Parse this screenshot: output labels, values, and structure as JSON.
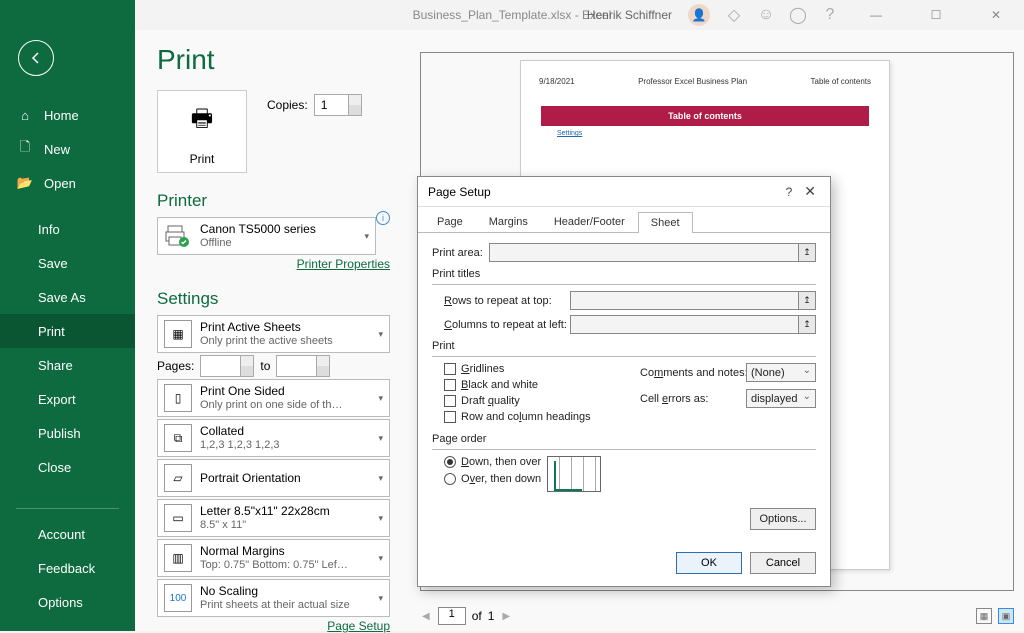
{
  "titlebar": {
    "filename": "Business_Plan_Template.xlsx  -  Excel",
    "user": "Henrik Schiffner"
  },
  "sidebar": {
    "home": "Home",
    "new": "New",
    "open": "Open",
    "info": "Info",
    "save": "Save",
    "save_as": "Save As",
    "print": "Print",
    "share": "Share",
    "export": "Export",
    "publish": "Publish",
    "close": "Close",
    "account": "Account",
    "feedback": "Feedback",
    "options": "Options"
  },
  "print": {
    "title": "Print",
    "print_btn": "Print",
    "copies_label": "Copies:",
    "copies_value": "1",
    "printer_section": "Printer",
    "printer_name": "Canon TS5000 series",
    "printer_status": "Offline",
    "printer_props": "Printer Properties",
    "settings_section": "Settings",
    "active_sheets_t": "Print Active Sheets",
    "active_sheets_s": "Only print the active sheets",
    "pages_label": "Pages:",
    "pages_to": "to",
    "one_sided_t": "Print One Sided",
    "one_sided_s": "Only print on one side of th…",
    "collated_t": "Collated",
    "collated_s": "1,2,3    1,2,3    1,2,3",
    "orientation": "Portrait Orientation",
    "paper_t": "Letter 8.5\"x11\" 22x28cm",
    "paper_s": "8.5\" x 11\"",
    "margins_t": "Normal Margins",
    "margins_s": "Top: 0.75\" Bottom: 0.75\" Lef…",
    "scaling_t": "No Scaling",
    "scaling_s": "Print sheets at their actual size",
    "page_setup_link": "Page Setup"
  },
  "preview": {
    "date": "9/18/2021",
    "center": "Professor Excel Business Plan",
    "right": "Table of contents",
    "toc_bar": "Table of contents",
    "link": "Settings",
    "page_current": "1",
    "page_of": "of",
    "page_total": "1"
  },
  "dialog": {
    "title": "Page Setup",
    "tab_page": "Page",
    "tab_margins": "Margins",
    "tab_hf": "Header/Footer",
    "tab_sheet": "Sheet",
    "print_area": "Print area:",
    "print_titles": "Print titles",
    "rows_repeat": "Rows to repeat at top:",
    "cols_repeat": "Columns to repeat at left:",
    "print_group": "Print",
    "gridlines": "Gridlines",
    "bw": "Black and white",
    "draft": "Draft quality",
    "rowcol": "Row and column headings",
    "comments_label": "Comments and notes:",
    "comments_val": "(None)",
    "errors_label": "Cell errors as:",
    "errors_val": "displayed",
    "page_order": "Page order",
    "down_over": "Down, then over",
    "over_down": "Over, then down",
    "options_btn": "Options...",
    "ok": "OK",
    "cancel": "Cancel"
  }
}
